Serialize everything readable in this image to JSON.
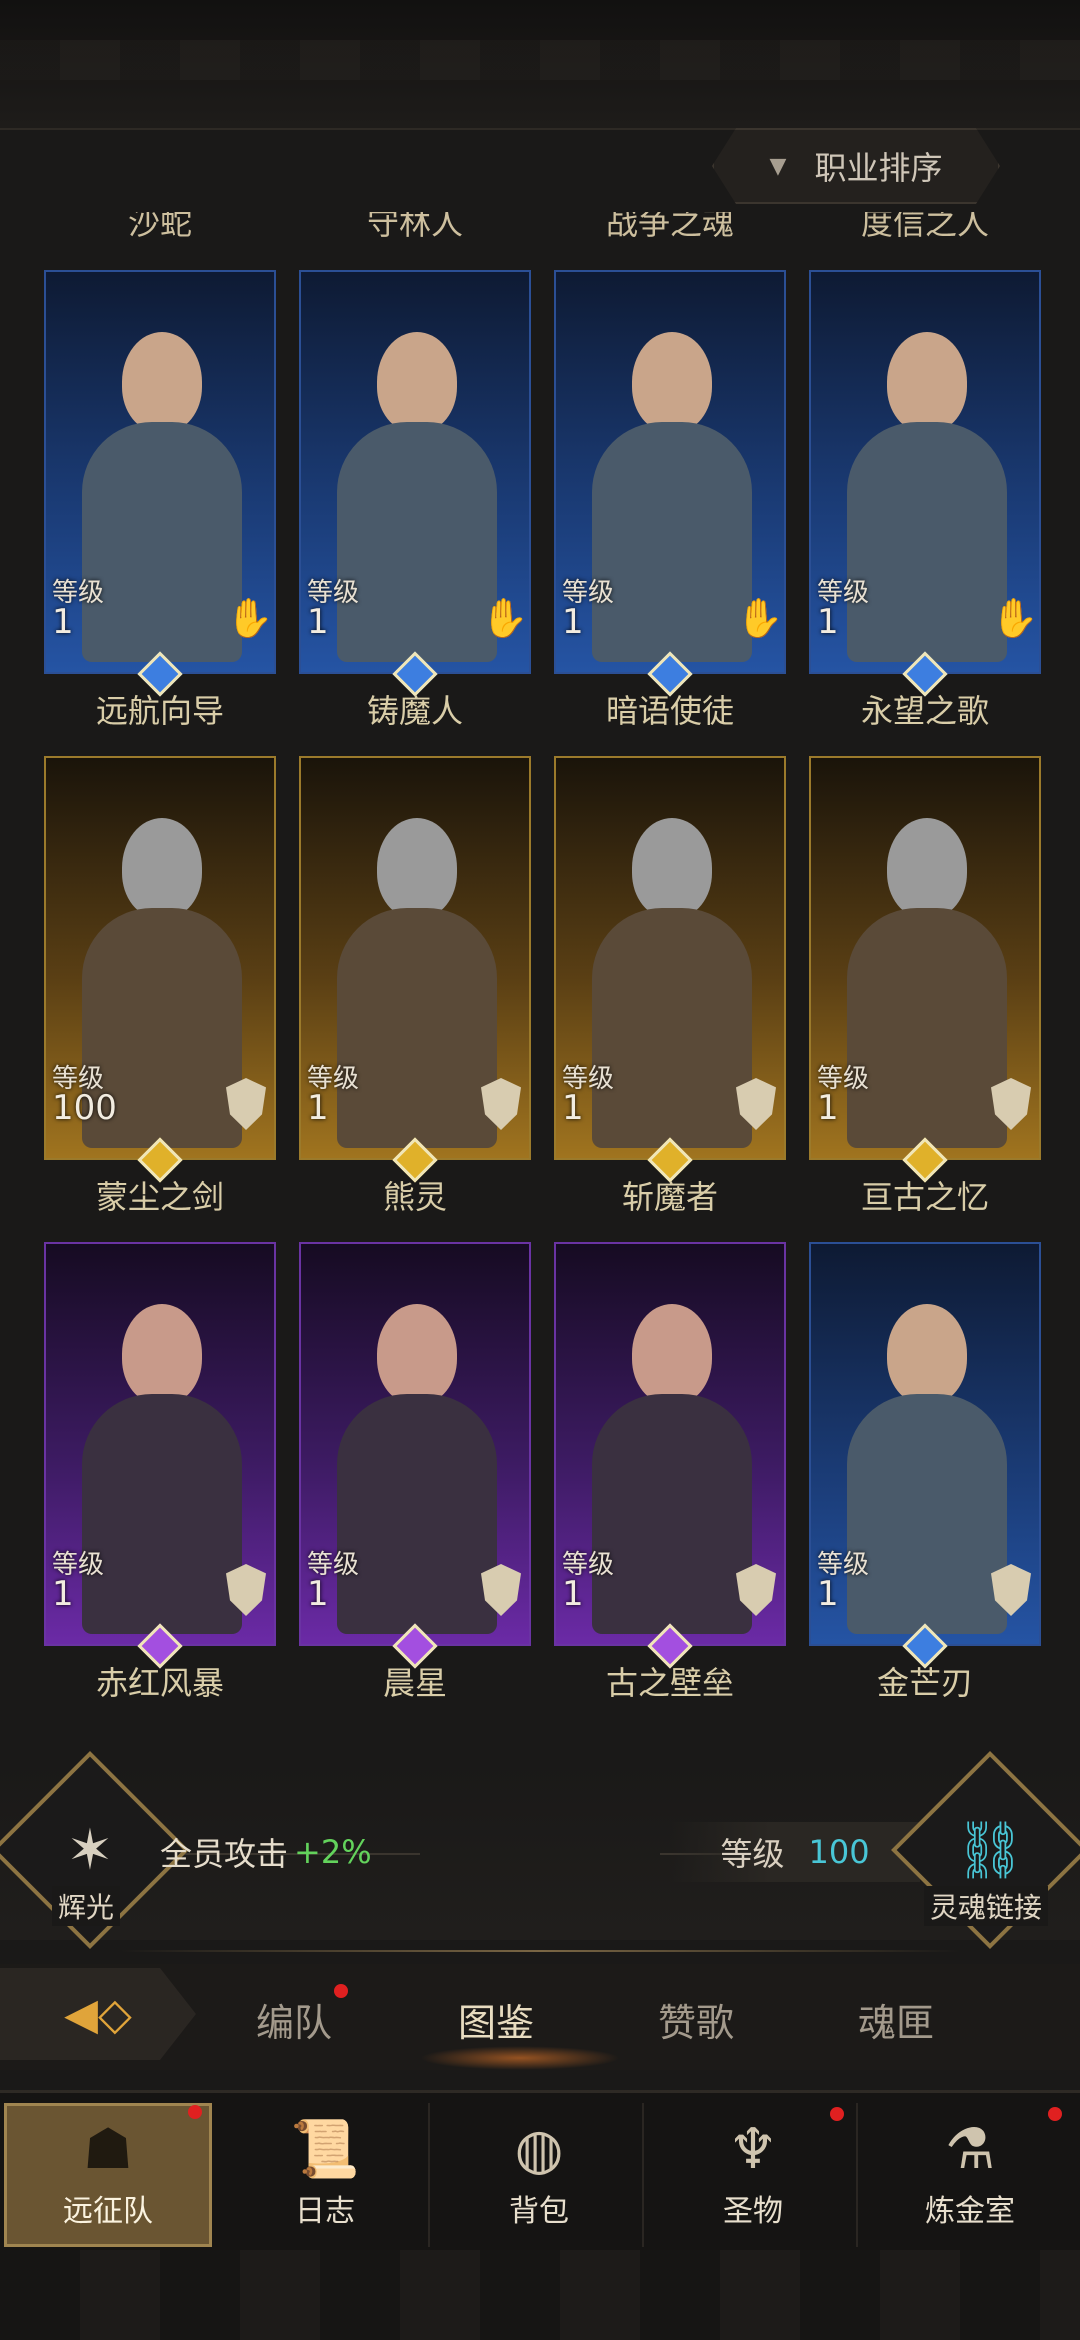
{
  "sort_button": {
    "label": "职业排序",
    "arrow": "▼"
  },
  "partial_names": [
    "沙蛇",
    "守林人",
    "战争之魂",
    "度信之人"
  ],
  "cards": [
    {
      "name": "远航向导",
      "level_label": "等级",
      "level": "1",
      "rarity": "blue",
      "class_icon": "hand-icon"
    },
    {
      "name": "铸魔人",
      "level_label": "等级",
      "level": "1",
      "rarity": "blue",
      "class_icon": "hand-icon"
    },
    {
      "name": "暗语使徒",
      "level_label": "等级",
      "level": "1",
      "rarity": "blue",
      "class_icon": "hand-icon"
    },
    {
      "name": "永望之歌",
      "level_label": "等级",
      "level": "1",
      "rarity": "blue",
      "class_icon": "hand-icon"
    },
    {
      "name": "蒙尘之剑",
      "level_label": "等级",
      "level": "100",
      "rarity": "gold",
      "class_icon": "shield-icon"
    },
    {
      "name": "熊灵",
      "level_label": "等级",
      "level": "1",
      "rarity": "gold",
      "class_icon": "shield-icon"
    },
    {
      "name": "斩魔者",
      "level_label": "等级",
      "level": "1",
      "rarity": "gold",
      "class_icon": "shield-icon"
    },
    {
      "name": "亘古之忆",
      "level_label": "等级",
      "level": "1",
      "rarity": "gold",
      "class_icon": "shield-icon"
    },
    {
      "name": "赤红风暴",
      "level_label": "等级",
      "level": "1",
      "rarity": "purple",
      "class_icon": "shield-icon"
    },
    {
      "name": "晨星",
      "level_label": "等级",
      "level": "1",
      "rarity": "purple",
      "class_icon": "shield-icon"
    },
    {
      "name": "古之壁垒",
      "level_label": "等级",
      "level": "1",
      "rarity": "purple",
      "class_icon": "shield-icon"
    },
    {
      "name": "金芒刃",
      "level_label": "等级",
      "level": "1",
      "rarity": "blue",
      "class_icon": "shield-icon"
    }
  ],
  "bonus": {
    "left_emblem_label": "辉光",
    "left_text": "全员攻击",
    "left_value": "+2%",
    "right_label": "等级",
    "right_value": "100",
    "right_emblem_label": "灵魂链接"
  },
  "tabs": [
    {
      "label": "编队",
      "active": false,
      "badge": true
    },
    {
      "label": "图鉴",
      "active": true,
      "badge": false
    },
    {
      "label": "赞歌",
      "active": false,
      "badge": false
    },
    {
      "label": "魂匣",
      "active": false,
      "badge": false
    }
  ],
  "bottom_nav": [
    {
      "label": "远征队",
      "icon": "helmet-icon",
      "active": true,
      "badge": true
    },
    {
      "label": "日志",
      "icon": "scroll-icon",
      "active": false,
      "badge": false
    },
    {
      "label": "背包",
      "icon": "bag-icon",
      "active": false,
      "badge": false
    },
    {
      "label": "圣物",
      "icon": "chalice-icon",
      "active": false,
      "badge": true
    },
    {
      "label": "炼金室",
      "icon": "alchemy-icon",
      "active": false,
      "badge": true
    }
  ],
  "colors": {
    "rarity_blue": "#2554a4",
    "rarity_gold": "#a0741f",
    "rarity_purple": "#6b2aa6",
    "bonus_green": "#63d35c",
    "level_cyan": "#49c6d6",
    "badge_red": "#e02020"
  }
}
